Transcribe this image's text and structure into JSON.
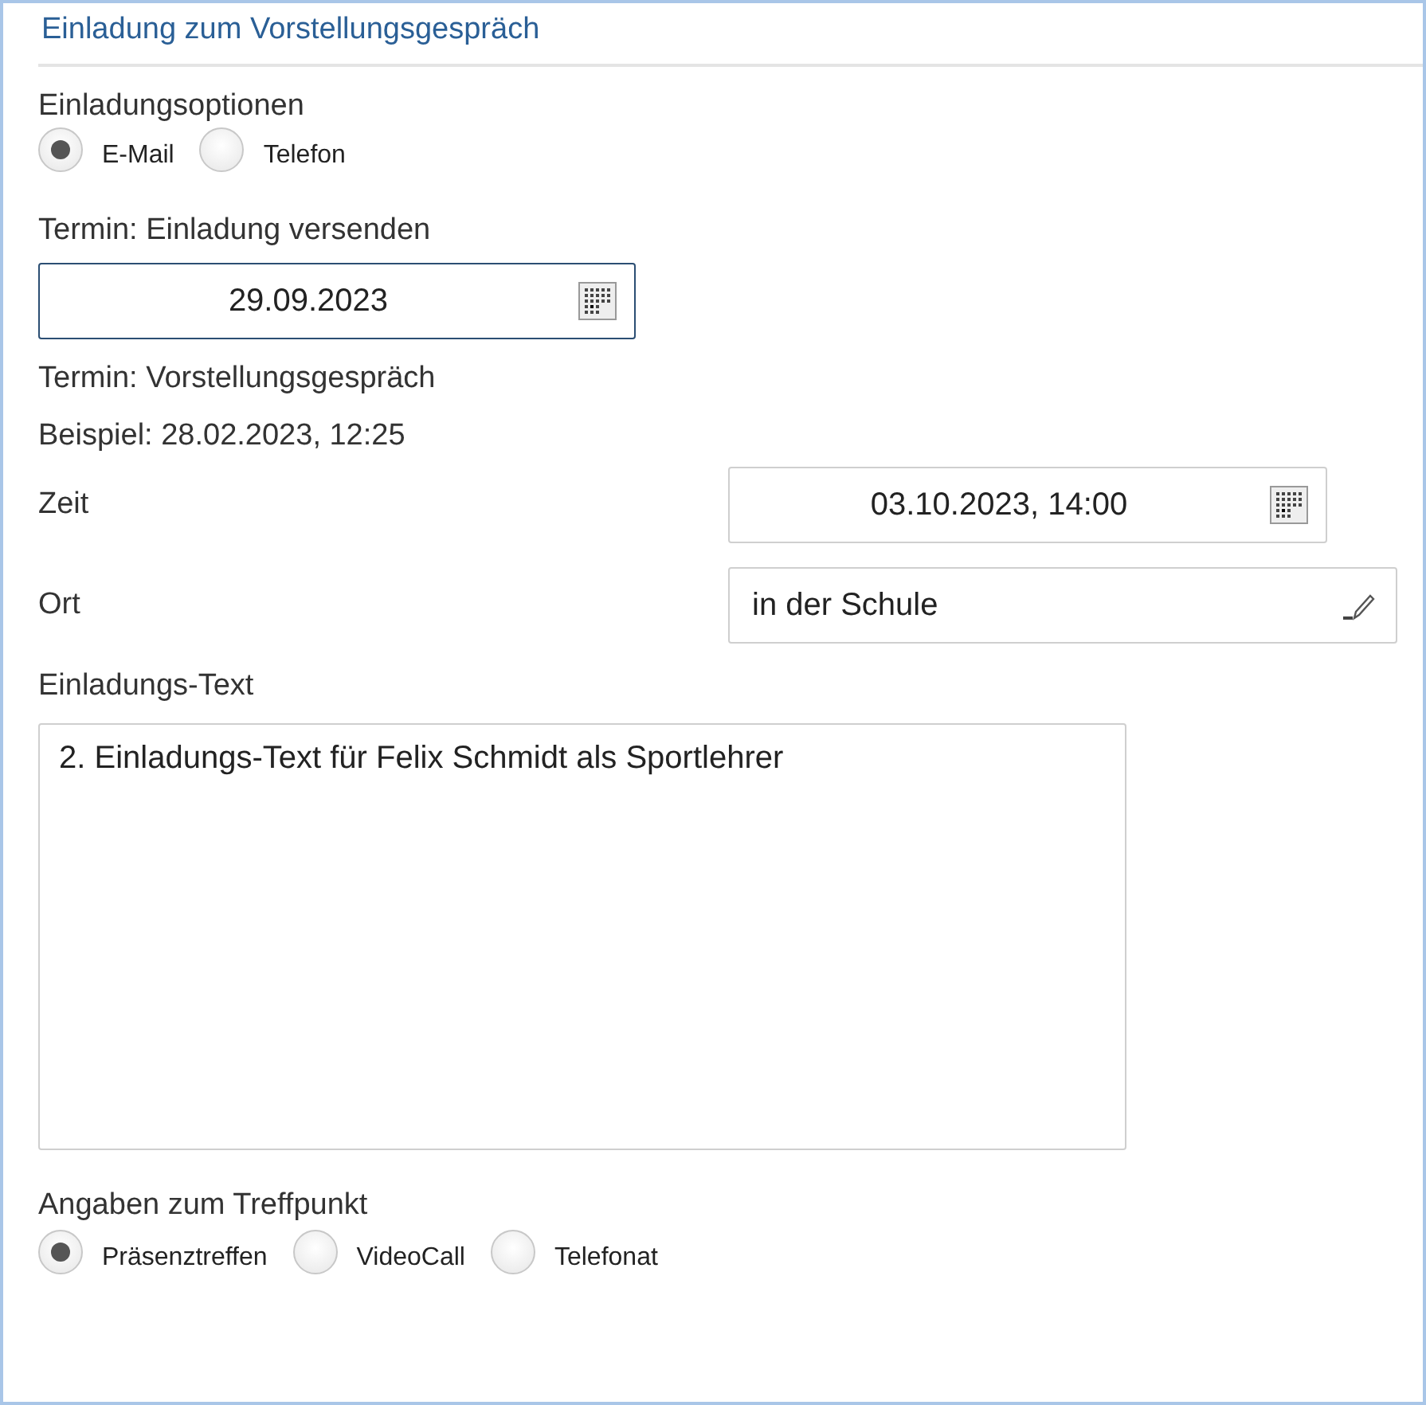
{
  "title": "Einladung zum Vorstellungsgespräch",
  "invitation_options": {
    "label": "Einladungsoptionen",
    "options": [
      {
        "label": "E-Mail",
        "selected": true
      },
      {
        "label": "Telefon",
        "selected": false
      }
    ]
  },
  "send_date": {
    "label": "Termin: Einladung versenden",
    "value": "29.09.2023"
  },
  "interview": {
    "label": "Termin: Vorstellungsgespräch",
    "hint": "Beispiel: 28.02.2023, 12:25",
    "time": {
      "label": "Zeit",
      "value": "03.10.2023, 14:00"
    },
    "place": {
      "label": "Ort",
      "value": "in der Schule"
    }
  },
  "invitation_text": {
    "label": "Einladungs-Text",
    "value": "2. Einladungs-Text für Felix Schmidt als Sportlehrer"
  },
  "meeting_point": {
    "label": "Angaben zum Treffpunkt",
    "options": [
      {
        "label": "Präsenztreffen",
        "selected": true
      },
      {
        "label": "VideoCall",
        "selected": false
      },
      {
        "label": "Telefonat",
        "selected": false
      }
    ]
  }
}
